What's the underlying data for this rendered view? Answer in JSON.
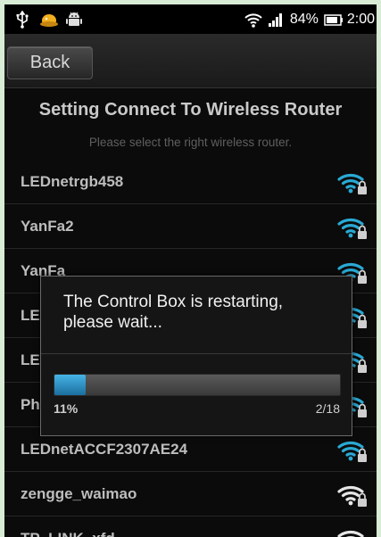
{
  "status_bar": {
    "battery": "84%",
    "time": "2:00",
    "icons": [
      "usb-icon",
      "notification-icon",
      "android-icon",
      "wifi-icon",
      "signal-icon",
      "battery-icon"
    ]
  },
  "header": {
    "back_label": "Back"
  },
  "page": {
    "title": "Setting Connect To Wireless Router",
    "subtitle": "Please select the right wireless router."
  },
  "networks": [
    {
      "ssid": "LEDnetrgb458",
      "secured": true
    },
    {
      "ssid": "YanFa2",
      "secured": true
    },
    {
      "ssid": "YanFa",
      "secured": true
    },
    {
      "ssid": "LE",
      "secured": true
    },
    {
      "ssid": "LE",
      "secured": true
    },
    {
      "ssid": "Ph",
      "secured": true
    },
    {
      "ssid": "LEDnetACCF2307AE24",
      "secured": true
    },
    {
      "ssid": "zengge_waimao",
      "secured": true
    },
    {
      "ssid": "TP_LINK_xfd",
      "secured": true
    }
  ],
  "dialog": {
    "message": "The Control Box is restarting, please wait...",
    "progress_percent_label": "11%",
    "progress_fraction": 0.11,
    "progress_count": "2/18"
  },
  "colors": {
    "wifi_accent": "#2aa9d4",
    "progress_blue": "#2b8fc4"
  }
}
